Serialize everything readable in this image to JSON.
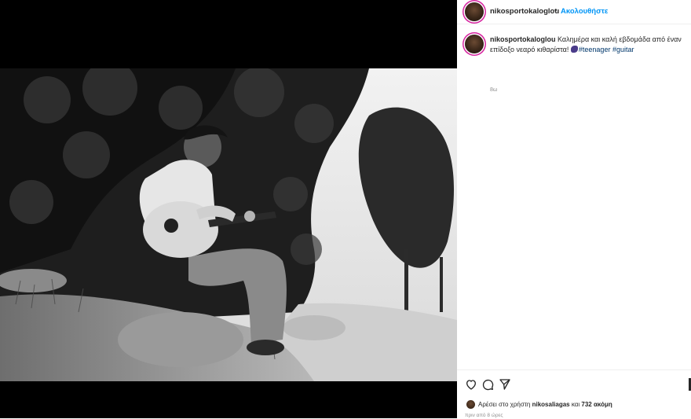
{
  "post": {
    "photo_alt": "Black and white photo of a young man playing an acoustic guitar seated on a rock among pine trees",
    "image_colors": {
      "frame": "#000000"
    }
  },
  "header": {
    "username": "nikosportokaloglou",
    "separator": "•",
    "follow_label": "Ακολουθήστε"
  },
  "caption": {
    "username": "nikosportokaloglou",
    "text": "Καλημέρα και καλή εβδομάδα από έναν επίδοξο νεαρό κιθαρίστα!",
    "emoji_icon": "guitar-emoji",
    "hashtags": [
      "#teenager",
      "#guitar"
    ],
    "time": "8ω"
  },
  "actions": {
    "like_icon": "heart-icon",
    "comment_icon": "comment-icon",
    "share_icon": "share-icon"
  },
  "likes": {
    "prefix": "Αρέσει στο χρήστη",
    "user": "nikosaliagas",
    "middle": "και",
    "count": "732 ακόμη"
  },
  "ago": "πριν από 8 ώρες",
  "colors": {
    "accent": "#0095f6",
    "hashtag": "#00376b",
    "text": "#262626",
    "muted": "#8e8e8e"
  }
}
